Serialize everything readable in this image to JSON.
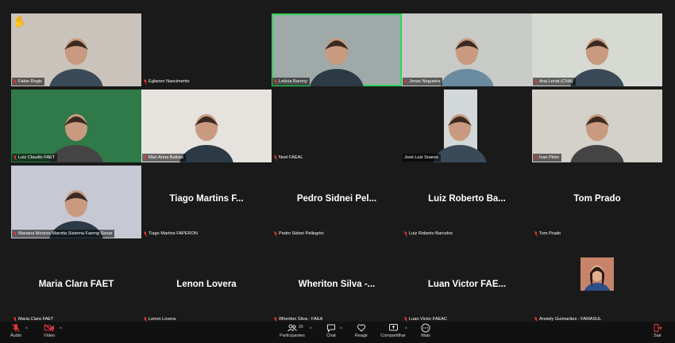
{
  "participants": [
    {
      "name": "Fabio Regis",
      "big": "",
      "video": true,
      "muted": true,
      "raised_hand": true,
      "active": false,
      "bg": "#c9c3bb"
    },
    {
      "name": "Eglanen Nascimento",
      "big": "",
      "video": false,
      "muted": true,
      "raised_hand": false,
      "active": false,
      "bg": "#1a1a1a"
    },
    {
      "name": "Letícia Barony",
      "big": "",
      "video": true,
      "muted": true,
      "raised_hand": false,
      "active": true,
      "bg": "#9fa9a8"
    },
    {
      "name": "Jonas Nogueira",
      "big": "",
      "video": true,
      "muted": true,
      "raised_hand": false,
      "active": false,
      "bg": "#c7cac6"
    },
    {
      "name": "Ana Lenat (CNA)",
      "big": "",
      "video": true,
      "muted": true,
      "raised_hand": false,
      "active": false,
      "bg": "#d6dad2"
    },
    {
      "name": "Luiz Claudio FAET",
      "big": "",
      "video": true,
      "muted": true,
      "raised_hand": false,
      "active": false,
      "bg": "#2f7a48"
    },
    {
      "name": "Mari Anna Batista",
      "big": "",
      "video": true,
      "muted": true,
      "raised_hand": false,
      "active": false,
      "bg": "#e6e2de"
    },
    {
      "name": "Noel FAEAL",
      "big": "",
      "video": false,
      "muted": true,
      "raised_hand": false,
      "active": false,
      "bg": "#1a1a1a"
    },
    {
      "name": "José Luiz Soares",
      "big": "",
      "video": true,
      "muted": false,
      "raised_hand": false,
      "active": false,
      "bg": "#1a1a1a"
    },
    {
      "name": "Ivan Pinto",
      "big": "",
      "video": true,
      "muted": true,
      "raised_hand": false,
      "active": false,
      "bg": "#d4d1ca"
    },
    {
      "name": "Mariana Moreira Marotta Sistema Faemg Senar",
      "big": "",
      "video": true,
      "muted": true,
      "raised_hand": false,
      "active": false,
      "bg": "#c6c8d4"
    },
    {
      "name": "Tiago Martins FAPERON",
      "big": "Tiago Martins F...",
      "video": false,
      "muted": true,
      "raised_hand": false,
      "active": false,
      "bg": "#1a1a1a"
    },
    {
      "name": "Pedro Sidnei Pellegrini",
      "big": "Pedro Sidnei Pel...",
      "video": false,
      "muted": true,
      "raised_hand": false,
      "active": false,
      "bg": "#1a1a1a"
    },
    {
      "name": "Luiz Roberto Barcelos",
      "big": "Luiz Roberto Ba...",
      "video": false,
      "muted": true,
      "raised_hand": false,
      "active": false,
      "bg": "#1a1a1a"
    },
    {
      "name": "Tom Prado",
      "big": "Tom Prado",
      "video": false,
      "muted": true,
      "raised_hand": false,
      "active": false,
      "bg": "#1a1a1a"
    },
    {
      "name": "Maria Clara FAET",
      "big": "Maria Clara FAET",
      "video": false,
      "muted": true,
      "raised_hand": false,
      "active": false,
      "bg": "#1a1a1a"
    },
    {
      "name": "Lenon Lovera",
      "big": "Lenon Lovera",
      "video": false,
      "muted": true,
      "raised_hand": false,
      "active": false,
      "bg": "#1a1a1a"
    },
    {
      "name": "Wheriton Silva - FAEA",
      "big": "Wheriton Silva -...",
      "video": false,
      "muted": true,
      "raised_hand": false,
      "active": false,
      "bg": "#1a1a1a"
    },
    {
      "name": "Luan Victor FAEAC",
      "big": "Luan Victor FAE...",
      "video": false,
      "muted": true,
      "raised_hand": false,
      "active": false,
      "bg": "#1a1a1a"
    },
    {
      "name": "Anniely Guimarães - FAMASUL",
      "big": "",
      "video": false,
      "muted": true,
      "raised_hand": false,
      "active": false,
      "bg": "#1a1a1a",
      "thumbnail": true
    }
  ],
  "toolbar": {
    "audio_label": "Áudio",
    "video_label": "Vídeo",
    "participants_label": "Participantes",
    "participants_count": "20",
    "chat_label": "Chat",
    "react_label": "Reagir",
    "share_label": "Compartilhar",
    "more_label": "Mais",
    "leave_label": "Sair"
  },
  "colors": {
    "muted": "#e0383e",
    "active_border": "#2fd35a",
    "background": "#1a1a1a",
    "leave": "#e0383e"
  }
}
